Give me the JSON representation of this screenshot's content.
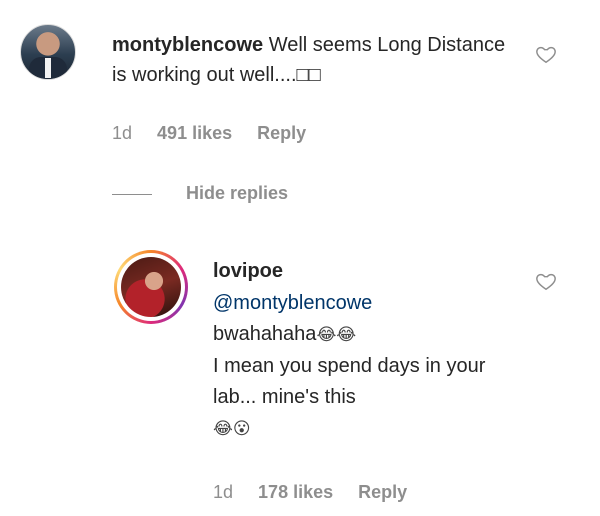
{
  "comment": {
    "username": "montyblencowe",
    "text": "Well seems Long Distance is working out well....□□",
    "time": "1d",
    "likes": "491 likes",
    "reply_label": "Reply"
  },
  "hide_replies_label": "Hide replies",
  "reply": {
    "username": "lovipoe",
    "mention": "@montyblencowe",
    "line1": "bwahahaha",
    "line1_emoji": "😂😂",
    "line2": "I mean you spend days in your lab... mine's this",
    "line2_emoji": "😂😮",
    "time": "1d",
    "likes": "178 likes",
    "reply_label": "Reply"
  },
  "icons": {
    "like": "heart-outline-icon"
  }
}
